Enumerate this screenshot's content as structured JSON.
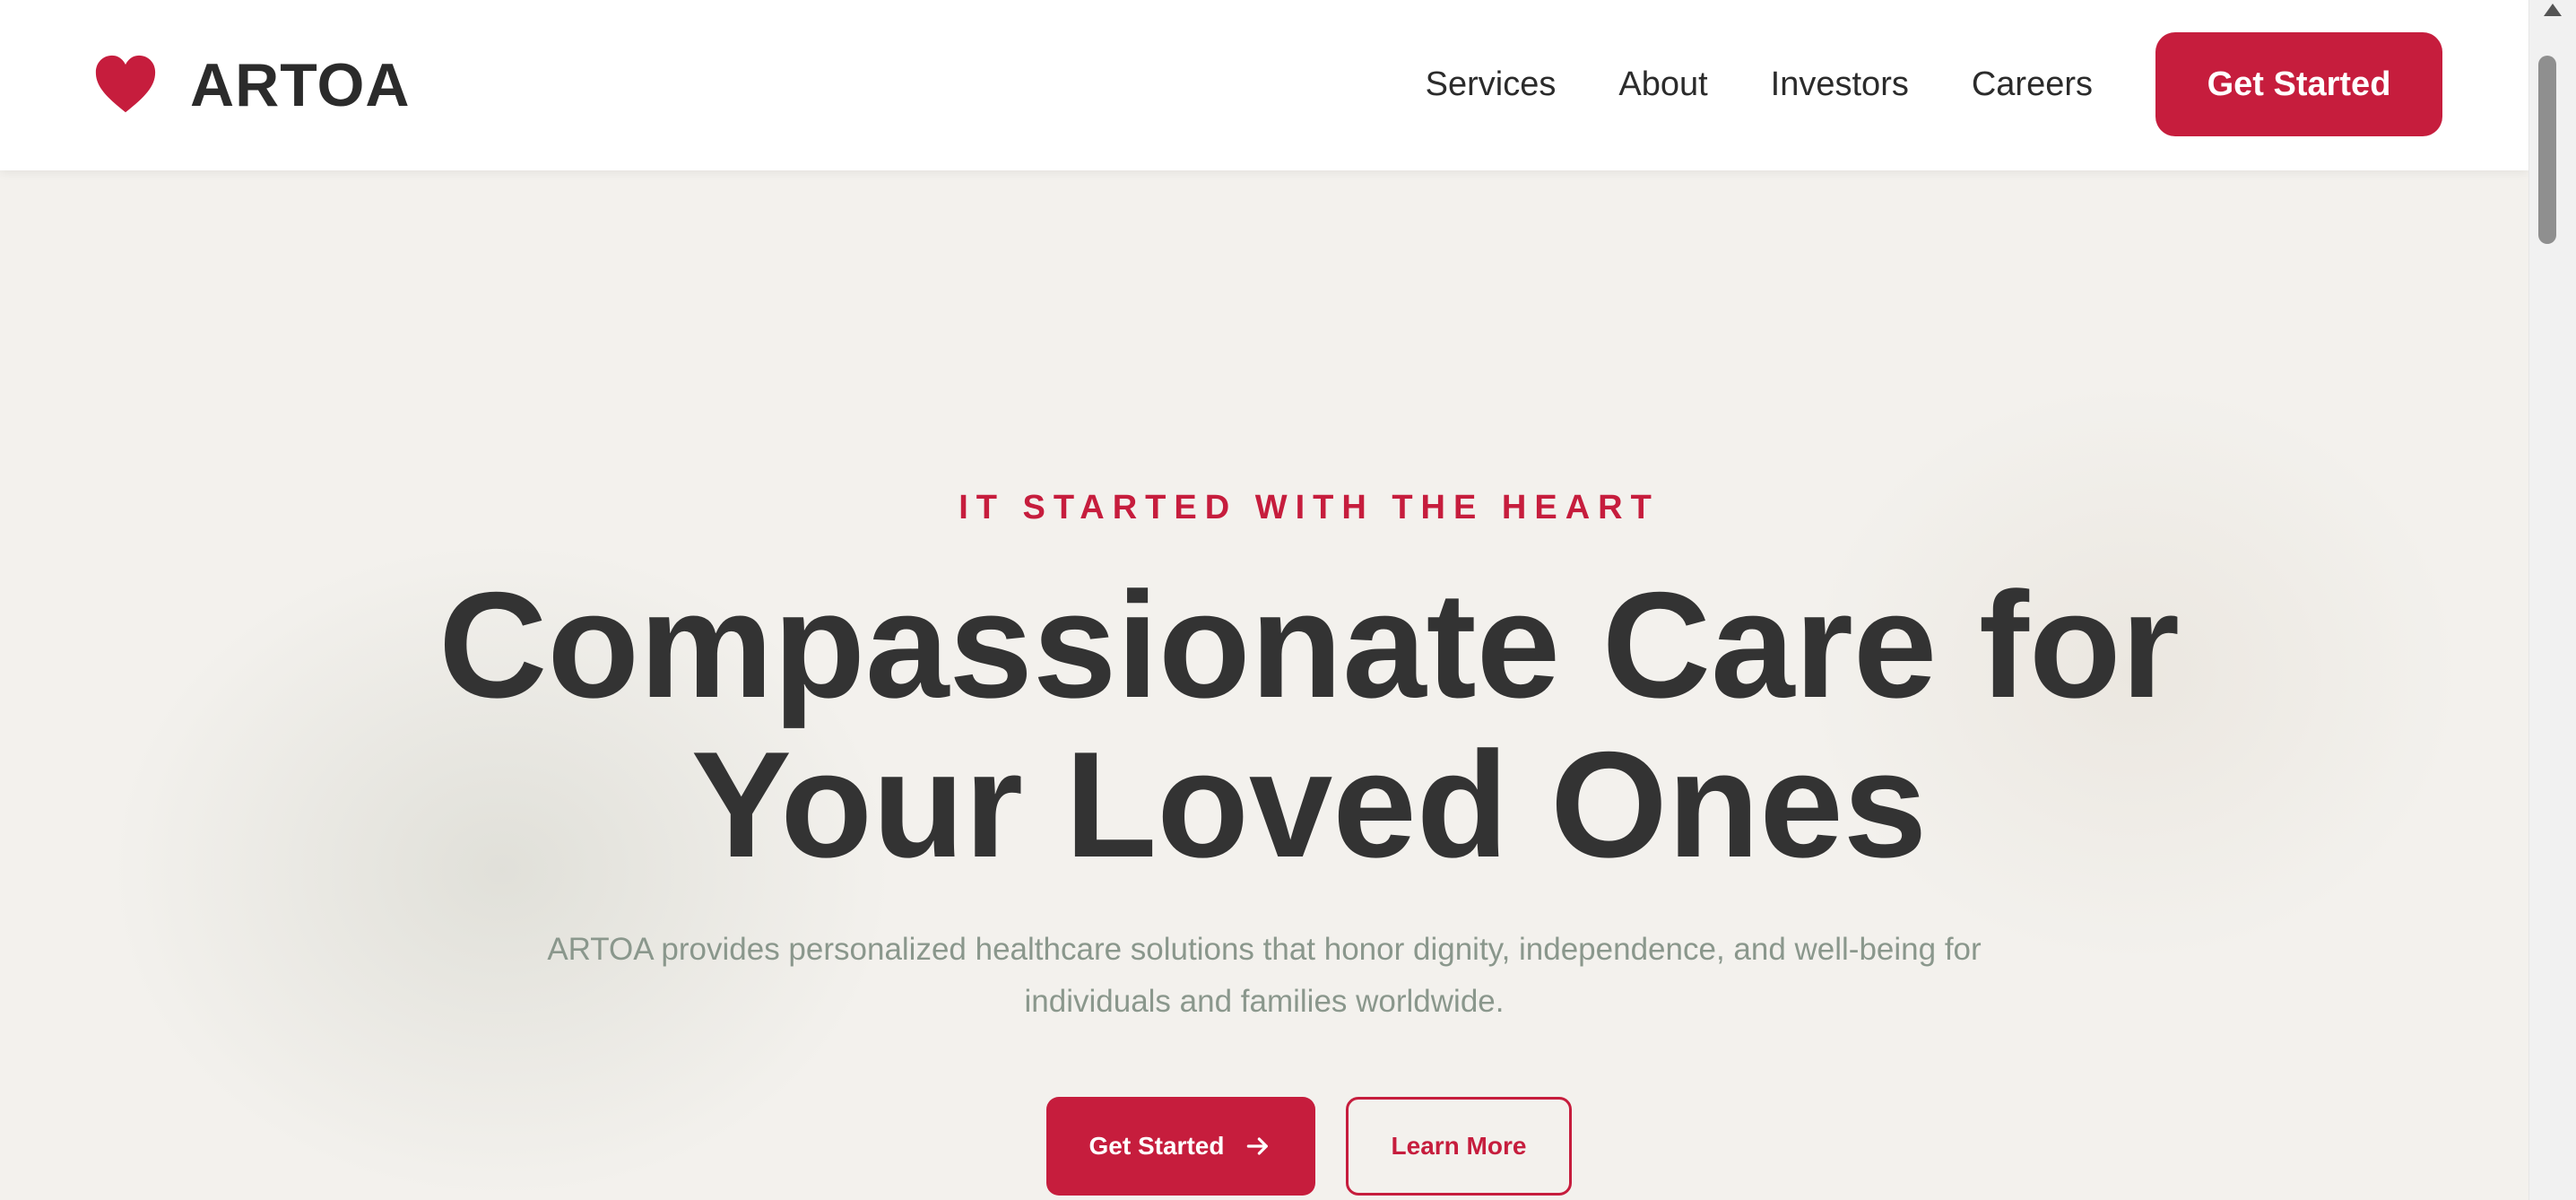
{
  "brand": {
    "name": "ARTOA",
    "accent_color": "#c61d3d",
    "logo_icon": "heart-icon"
  },
  "nav": {
    "links": [
      "Services",
      "About",
      "Investors",
      "Careers"
    ],
    "cta_label": "Get Started"
  },
  "hero": {
    "kicker": "IT STARTED WITH THE HEART",
    "headline_line1": "Compassionate Care for",
    "headline_line2": "Your Loved Ones",
    "subtext": "ARTOA provides personalized healthcare solutions that honor dignity, independence, and well-being for individuals and families worldwide.",
    "primary_button_label": "Get Started",
    "primary_button_icon": "arrow-right-icon",
    "secondary_button_label": "Learn More"
  }
}
